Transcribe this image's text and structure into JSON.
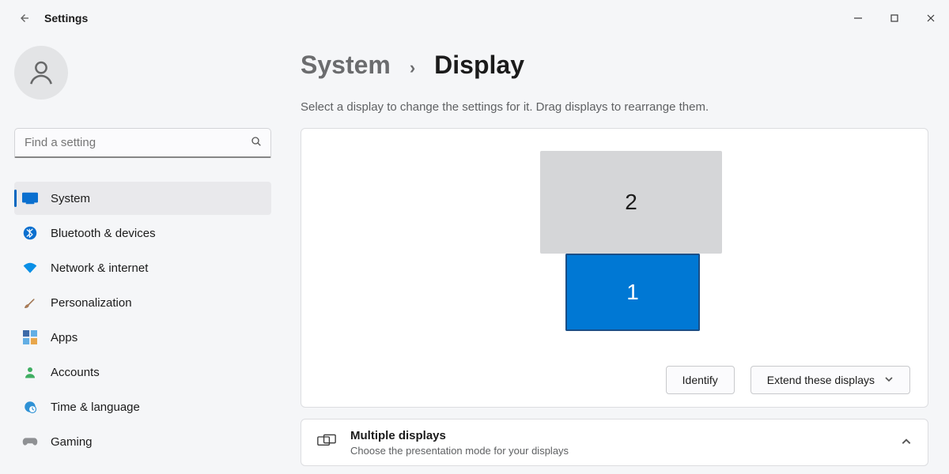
{
  "window": {
    "title": "Settings"
  },
  "search": {
    "placeholder": "Find a setting"
  },
  "sidebar": {
    "items": [
      {
        "label": "System",
        "icon": "system-icon",
        "selected": true
      },
      {
        "label": "Bluetooth & devices",
        "icon": "bluetooth-icon"
      },
      {
        "label": "Network & internet",
        "icon": "wifi-icon"
      },
      {
        "label": "Personalization",
        "icon": "brush-icon"
      },
      {
        "label": "Apps",
        "icon": "apps-icon"
      },
      {
        "label": "Accounts",
        "icon": "accounts-icon"
      },
      {
        "label": "Time & language",
        "icon": "time-icon"
      },
      {
        "label": "Gaming",
        "icon": "gaming-icon"
      }
    ]
  },
  "breadcrumb": {
    "parent": "System",
    "current": "Display"
  },
  "help_text": "Select a display to change the settings for it. Drag displays to rearrange them.",
  "monitors": {
    "primary": "1",
    "secondary": "2"
  },
  "actions": {
    "identify": "Identify",
    "mode_dropdown": "Extend these displays"
  },
  "multiple_displays": {
    "title": "Multiple displays",
    "subtitle": "Choose the presentation mode for your displays"
  }
}
